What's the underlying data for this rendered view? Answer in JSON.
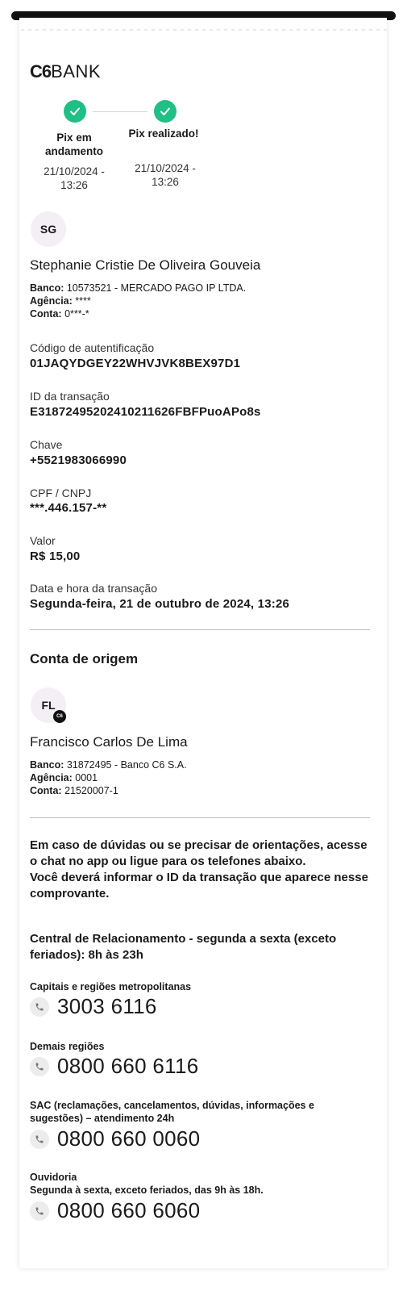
{
  "brand": {
    "logo_bold": "C6",
    "logo_light": "BANK"
  },
  "steps": [
    {
      "title": "Pix em andamento",
      "date": "21/10/2024 - 13:26"
    },
    {
      "title": "Pix realizado!",
      "date": "21/10/2024 - 13:26"
    }
  ],
  "recipient": {
    "initials": "SG",
    "name": "Stephanie Cristie De Oliveira Gouveia",
    "banco_label": "Banco:",
    "banco": "10573521 - MERCADO PAGO IP LTDA.",
    "agencia_label": "Agência:",
    "agencia": "****",
    "conta_label": "Conta:",
    "conta": "0***-*"
  },
  "fields": [
    {
      "label": "Código de autentificação",
      "value": "01JAQYDGEY22WHVJVK8BEX97D1"
    },
    {
      "label": "ID da transação",
      "value": "E31872495202410211626FBFPuoAPo8s"
    },
    {
      "label": "Chave",
      "value": "+5521983066990"
    },
    {
      "label": "CPF / CNPJ",
      "value": "***.446.157-**"
    },
    {
      "label": "Valor",
      "value": "R$ 15,00"
    },
    {
      "label": "Data e hora da transação",
      "value": "Segunda-feira, 21 de outubro de 2024, 13:26"
    }
  ],
  "origin": {
    "section_title": "Conta de origem",
    "initials": "FL",
    "badge": "C6",
    "name": "Francisco Carlos De Lima",
    "banco_label": "Banco:",
    "banco": "31872495 - Banco C6 S.A.",
    "agencia_label": "Agência:",
    "agencia": "0001",
    "conta_label": "Conta:",
    "conta": "21520007-1"
  },
  "help": {
    "line1": "Em caso de dúvidas ou se precisar de orientações, acesse o chat no app ou ligue para os telefones abaixo.",
    "line2": "Você deverá informar o ID da transação que aparece nesse comprovante.",
    "central": "Central de Relacionamento - segunda a sexta (exceto feriados): 8h às 23h"
  },
  "phones": [
    {
      "label": "Capitais e regiões metropolitanas",
      "number": "3003 6116"
    },
    {
      "label": "Demais regiões",
      "number": "0800 660 6116"
    },
    {
      "label": "SAC (reclamações, cancelamentos, dúvidas, informações e sugestões) – atendimento 24h",
      "number": "0800 660 0060"
    },
    {
      "label": "Ouvidoria",
      "sublabel": "Segunda à sexta, exceto feriados, das 9h às 18h.",
      "number": "0800 660 6060"
    }
  ],
  "colors": {
    "accent_green": "#1fbf86"
  },
  "icons": {
    "check": "check-icon",
    "phone": "phone-icon"
  }
}
